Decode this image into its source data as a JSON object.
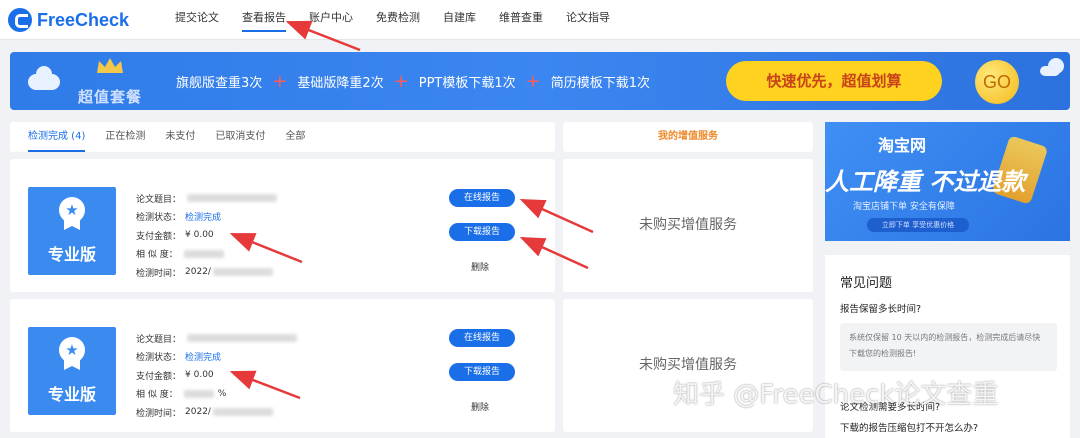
{
  "brand": {
    "logo_text": "FreeCheck"
  },
  "nav": [
    "提交论文",
    "查看报告",
    "账户中心",
    "免费检测",
    "自建库",
    "维普查重",
    "论文指导"
  ],
  "banner": {
    "package_label": "超值套餐",
    "items": [
      "旗舰版查重3次",
      "基础版降重2次",
      "PPT模板下载1次",
      "简历模板下载1次"
    ],
    "plus": "+",
    "cta": "快速优先，超值划算",
    "go": "GO"
  },
  "tabs": [
    "检测完成 (4)",
    "正在检测",
    "未支付",
    "已取消支付",
    "全部"
  ],
  "service_header": "我的增值服务",
  "reports": [
    {
      "badge": "专业版",
      "labels": {
        "title": "论文题目：",
        "status": "检测状态：",
        "amount": "支付金额：",
        "similarity": "相 似 度：",
        "time": "检测时间："
      },
      "status": "检测完成",
      "amount": "¥ 0.00",
      "time": "2022/",
      "btn_online": "在线报告",
      "btn_download": "下载报告",
      "delete": "删除",
      "service": "未购买增值服务"
    },
    {
      "badge": "专业版",
      "labels": {
        "title": "论文题目：",
        "status": "检测状态：",
        "amount": "支付金额：",
        "similarity": "相 似 度：",
        "time": "检测时间："
      },
      "status": "检测完成",
      "amount": "¥ 0.00",
      "similarity_suffix": "%",
      "time": "2022/",
      "btn_online": "在线报告",
      "btn_download": "下载报告",
      "delete": "删除",
      "service": "未购买增值服务"
    }
  ],
  "taobao": {
    "title": "淘宝网",
    "slogan": "人工降重  不过退款",
    "sub": "淘宝店铺下单        安全有保障",
    "button": "立即下单 享受优惠价格"
  },
  "faq": {
    "title": "常见问题",
    "q1": "报告保留多长时间?",
    "a1": "系统仅保留 10 天以内的检测报告，检测完成后请尽快下载您的检测报告!",
    "q2": "论文检测需要多长时间?",
    "q3": "下载的报告压缩包打不开怎么办?"
  },
  "watermark": "知乎 @FreeCheck论文查重",
  "colors": {
    "primary": "#1a6fe8",
    "accent_orange": "#ef8a2a",
    "cta_yellow": "#ffd21f",
    "annotation_red": "#e63a3a"
  }
}
